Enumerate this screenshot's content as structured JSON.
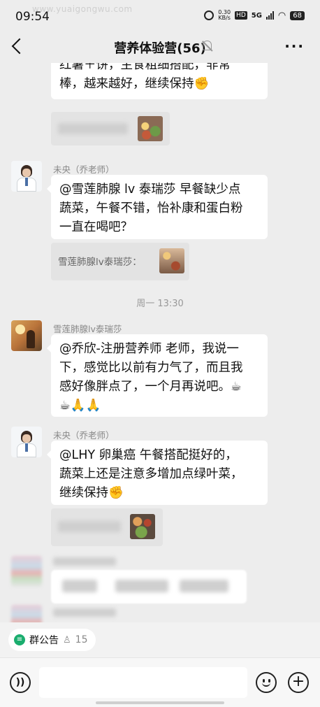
{
  "status_bar": {
    "time": "09:54",
    "watermark": "www.yuaigongwu.com",
    "net_speed_value": "0.30",
    "net_speed_unit": "KB/s",
    "hd": "HD",
    "network": "5G",
    "battery": "68"
  },
  "nav": {
    "title": "营养体验营(56)",
    "more": "···"
  },
  "messages": [
    {
      "text_lines": [
        "红薯＋饼，主食粗细搭配，非常",
        "棒，越来越好，继续保持✊"
      ]
    },
    {
      "sender": "未央（乔老师）",
      "text_lines": [
        "@雪莲肺腺 lv 泰瑞莎  早餐缺少点",
        "蔬菜，午餐不错，怡补康和蛋白粉",
        "一直在喝吧？"
      ],
      "quote": "雪莲肺腺lv泰瑞莎："
    },
    {
      "sender": "雪莲肺腺lv泰瑞莎",
      "text_lines": [
        "@乔欣-注册营养师  老师，我说一",
        "下，感觉比以前有力气了，而且我",
        "感好像胖点了，一个月再说吧。☕",
        "☕🙏🙏"
      ]
    },
    {
      "sender": "未央（乔老师）",
      "text_lines": [
        "@LHY 卵巢癌  午餐搭配挺好的，",
        "蔬菜上还是注意多增加点绿叶菜，",
        "继续保持✊"
      ]
    }
  ],
  "time_separator": "周一 13:30",
  "notice": {
    "label": "群公告",
    "member_count": "15"
  },
  "colors": {
    "background": "#ededed",
    "bubble": "#ffffff",
    "notice_green": "#1aad6e"
  }
}
